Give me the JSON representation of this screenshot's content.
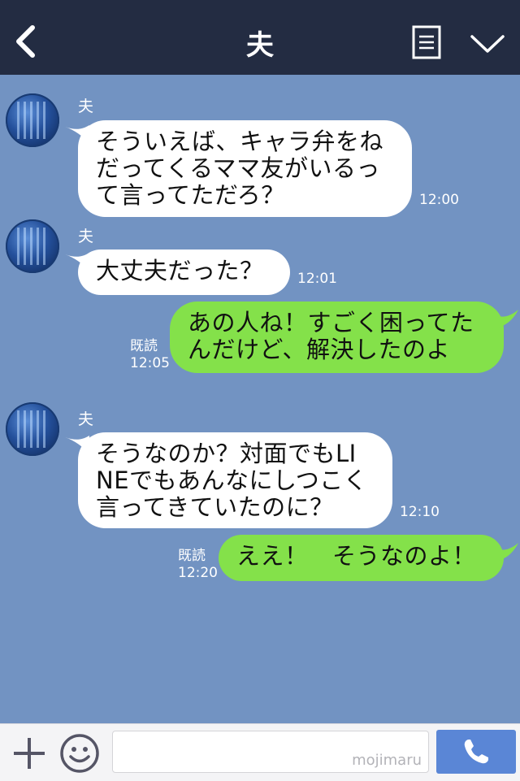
{
  "header": {
    "title": "夫"
  },
  "messages": [
    {
      "sender": "夫",
      "direction": "in",
      "lines": [
        "そういえば、キャラ弁をね",
        "だってくるママ友がいるっ",
        "て言ってただろ？"
      ],
      "time": "12:00"
    },
    {
      "sender": "夫",
      "direction": "in",
      "lines": [
        "大丈夫だった？"
      ],
      "time": "12:01"
    },
    {
      "direction": "out",
      "lines": [
        "あの人ね！すごく困ってた",
        "んだけど、解決したのよ"
      ],
      "read": "既読",
      "time": "12:05"
    },
    {
      "sender": "夫",
      "direction": "in",
      "lines": [
        "そうなのか？対面でもLI",
        "NEでもあんなにしつこく",
        "言ってきていたのに？"
      ],
      "time": "12:10"
    },
    {
      "direction": "out",
      "lines": [
        "ええ！　そうなのよ！"
      ],
      "read": "既読",
      "time": "12:20"
    }
  ],
  "footer": {
    "watermark": "mojimaru"
  },
  "colors": {
    "header": "#232c42",
    "background": "#7293c2",
    "outgoing": "#84e14a",
    "incoming": "#ffffff",
    "call": "#5a86d6"
  }
}
